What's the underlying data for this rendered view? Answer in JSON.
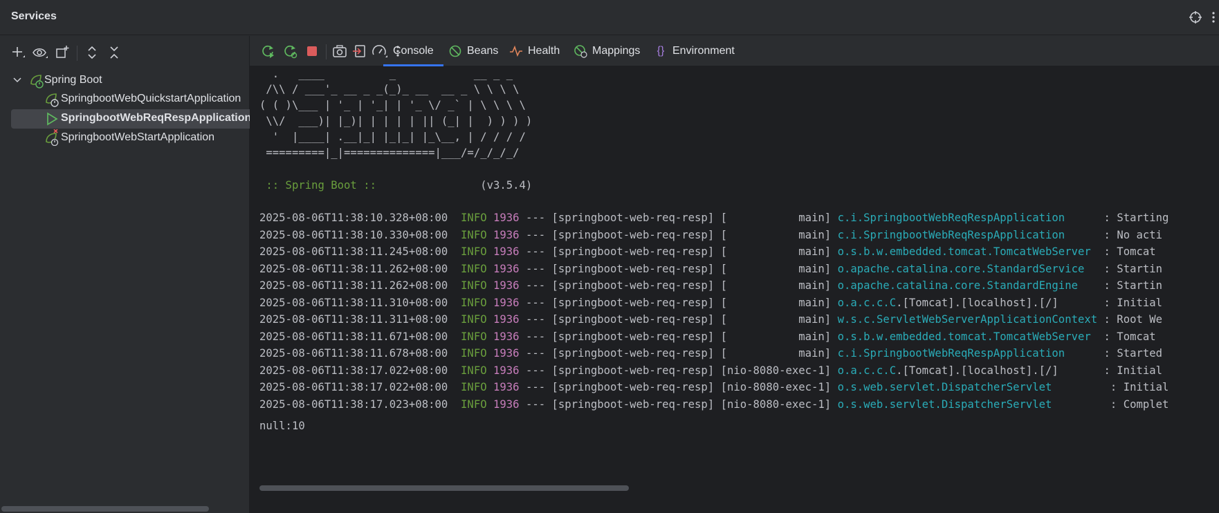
{
  "window": {
    "title": "Services"
  },
  "sidebar": {
    "tools": [
      "add-icon",
      "eye-icon",
      "new-group-icon",
      "expand-all-icon",
      "collapse-all-icon"
    ],
    "root": {
      "label": "Spring Boot"
    },
    "items": [
      {
        "label": "SpringbootWebQuickstartApplication",
        "status": "stopped"
      },
      {
        "label": "SpringbootWebReqRespApplication",
        "status": "running",
        "selected": true
      },
      {
        "label": "SpringbootWebStartApplication",
        "status": "error"
      }
    ]
  },
  "toolbar": {
    "tabs": [
      {
        "label": "Console",
        "icon": "console",
        "active": true
      },
      {
        "label": "Beans",
        "icon": "beans-icon"
      },
      {
        "label": "Health",
        "icon": "health-icon"
      },
      {
        "label": "Mappings",
        "icon": "mappings-icon"
      },
      {
        "label": "Environment",
        "icon": "environment-icon"
      }
    ]
  },
  "console": {
    "banner": [
      "  .   ____          _            __ _ _",
      " /\\\\ / ___'_ __ _ _(_)_ __  __ _ \\ \\ \\ \\",
      "( ( )\\___ | '_ | '_| | '_ \\/ _` | \\ \\ \\ \\",
      " \\\\/  ___)| |_)| | | | | || (_| |  ) ) ) )",
      "  '  |____| .__|_| |_|_| |_\\__, | / / / /",
      " =========|_|==============|___/=/_/_/_/"
    ],
    "spring_label": " :: Spring Boot :: ",
    "spring_version": "               (v3.5.4)",
    "logs": [
      {
        "ts": "2025-08-06T11:38:10.328+08:00",
        "level": "INFO",
        "pid": "1936",
        "app": "--- [springboot-web-req-resp] [           main] ",
        "pkg": "c.i.",
        "cls": "SpringbootWebReqRespApplication",
        "pad": "      ",
        "msg": ": Starting"
      },
      {
        "ts": "2025-08-06T11:38:10.330+08:00",
        "level": "INFO",
        "pid": "1936",
        "app": "--- [springboot-web-req-resp] [           main] ",
        "pkg": "c.i.",
        "cls": "SpringbootWebReqRespApplication",
        "pad": "      ",
        "msg": ": No acti"
      },
      {
        "ts": "2025-08-06T11:38:11.245+08:00",
        "level": "INFO",
        "pid": "1936",
        "app": "--- [springboot-web-req-resp] [           main] ",
        "pkg": "o.s.b.w.embedded.tomcat.",
        "cls": "TomcatWebServer",
        "pad": "  ",
        "msg": ": Tomcat"
      },
      {
        "ts": "2025-08-06T11:38:11.262+08:00",
        "level": "INFO",
        "pid": "1936",
        "app": "--- [springboot-web-req-resp] [           main] ",
        "pkg": "o.apache.catalina.core.",
        "cls": "StandardService",
        "pad": "   ",
        "msg": ": Startin"
      },
      {
        "ts": "2025-08-06T11:38:11.262+08:00",
        "level": "INFO",
        "pid": "1936",
        "app": "--- [springboot-web-req-resp] [           main] ",
        "pkg": "o.apache.catalina.core.",
        "cls": "StandardEngine",
        "pad": "    ",
        "msg": ": Startin"
      },
      {
        "ts": "2025-08-06T11:38:11.310+08:00",
        "level": "INFO",
        "pid": "1936",
        "app": "--- [springboot-web-req-resp] [           main] ",
        "pkg": "o.a.c.c.",
        "cls": "C",
        "pad": "",
        "msg": ".[Tomcat].[localhost].[/]       : Initial"
      },
      {
        "ts": "2025-08-06T11:38:11.311+08:00",
        "level": "INFO",
        "pid": "1936",
        "app": "--- [springboot-web-req-resp] [           main] ",
        "pkg": "w.s.c.",
        "cls": "ServletWebServerApplicationContext",
        "pad": " ",
        "msg": ": Root We"
      },
      {
        "ts": "2025-08-06T11:38:11.671+08:00",
        "level": "INFO",
        "pid": "1936",
        "app": "--- [springboot-web-req-resp] [           main] ",
        "pkg": "o.s.b.w.embedded.tomcat.",
        "cls": "TomcatWebServer",
        "pad": "  ",
        "msg": ": Tomcat"
      },
      {
        "ts": "2025-08-06T11:38:11.678+08:00",
        "level": "INFO",
        "pid": "1936",
        "app": "--- [springboot-web-req-resp] [           main] ",
        "pkg": "c.i.",
        "cls": "SpringbootWebReqRespApplication",
        "pad": "      ",
        "msg": ": Started"
      },
      {
        "ts": "2025-08-06T11:38:17.022+08:00",
        "level": "INFO",
        "pid": "1936",
        "app": "--- [springboot-web-req-resp] [nio-8080-exec-1] ",
        "pkg": "o.a.c.c.",
        "cls": "C",
        "pad": "",
        "msg": ".[Tomcat].[localhost].[/]       : Initial"
      },
      {
        "ts": "2025-08-06T11:38:17.022+08:00",
        "level": "INFO",
        "pid": "1936",
        "app": "--- [springboot-web-req-resp] [nio-8080-exec-1] ",
        "pkg": "o.s.web.servlet.",
        "cls": "DispatcherServlet",
        "pad": "         ",
        "msg": ": Initial"
      },
      {
        "ts": "2025-08-06T11:38:17.023+08:00",
        "level": "INFO",
        "pid": "1936",
        "app": "--- [springboot-web-req-resp] [nio-8080-exec-1] ",
        "pkg": "o.s.web.servlet.",
        "cls": "DispatcherServlet",
        "pad": "         ",
        "msg": ": Complet"
      }
    ],
    "output": "null:10"
  },
  "colors": {
    "accent": "#3574f0",
    "info": "#6a9f3d",
    "pid": "#c77dbb",
    "logger": "#2aacb8",
    "running": "#5fb85f",
    "error": "#e55757"
  }
}
